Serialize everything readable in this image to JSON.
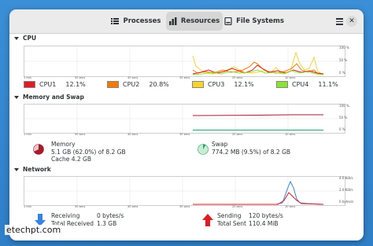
{
  "tabs": [
    {
      "label": "Processes",
      "icon": "list-icon"
    },
    {
      "label": "Resources",
      "icon": "chart-icon"
    },
    {
      "label": "File Systems",
      "icon": "disk-icon"
    }
  ],
  "cpu": {
    "title": "CPU",
    "time_labels": [
      "1 min",
      "50 secs",
      "40 secs",
      "30 secs",
      "20 secs",
      "10 secs"
    ],
    "y_labels": [
      "100 %",
      "50 %",
      "0 %"
    ],
    "legend": [
      {
        "name": "CPU1",
        "value": "12.1%",
        "color": "#e01b24"
      },
      {
        "name": "CPU2",
        "value": "20.8%",
        "color": "#f57900"
      },
      {
        "name": "CPU3",
        "value": "12.1%",
        "color": "#f6d32d"
      },
      {
        "name": "CPU4",
        "value": "11.1%",
        "color": "#8ae234"
      }
    ]
  },
  "memory": {
    "title": "Memory and Swap",
    "time_labels": [
      "1 min",
      "50 secs",
      "40 secs",
      "30 secs",
      "20 secs",
      "10 secs"
    ],
    "y_labels": [
      "100 %",
      "50 %",
      "0 %"
    ],
    "mem_label": "Memory",
    "mem_value": "5.1 GB (62.0%) of 8.2 GB",
    "cache_value": "Cache 4.2 GB",
    "swap_label": "Swap",
    "swap_value": "774.2 MB (9.5%) of 8.2 GB",
    "mem_color": "#a51d2d",
    "swap_color": "#26a269"
  },
  "network": {
    "title": "Network",
    "time_labels": [
      "1 min",
      "50 secs",
      "40 secs",
      "30 secs",
      "20 secs",
      "10 secs"
    ],
    "y_labels": [
      "4.0 KiB/s",
      "2.0 KiB/s",
      "0 bytes/s"
    ],
    "receiving_label": "Receiving",
    "receiving_rate": "0 bytes/s",
    "total_received_label": "Total Received",
    "total_received": "1.3 GB",
    "sending_label": "Sending",
    "sending_rate": "120 bytes/s",
    "total_sent_label": "Total Sent",
    "total_sent": "110.4 MiB",
    "recv_color": "#3584e4",
    "send_color": "#e01b24"
  },
  "watermark": "etechpt.com"
}
